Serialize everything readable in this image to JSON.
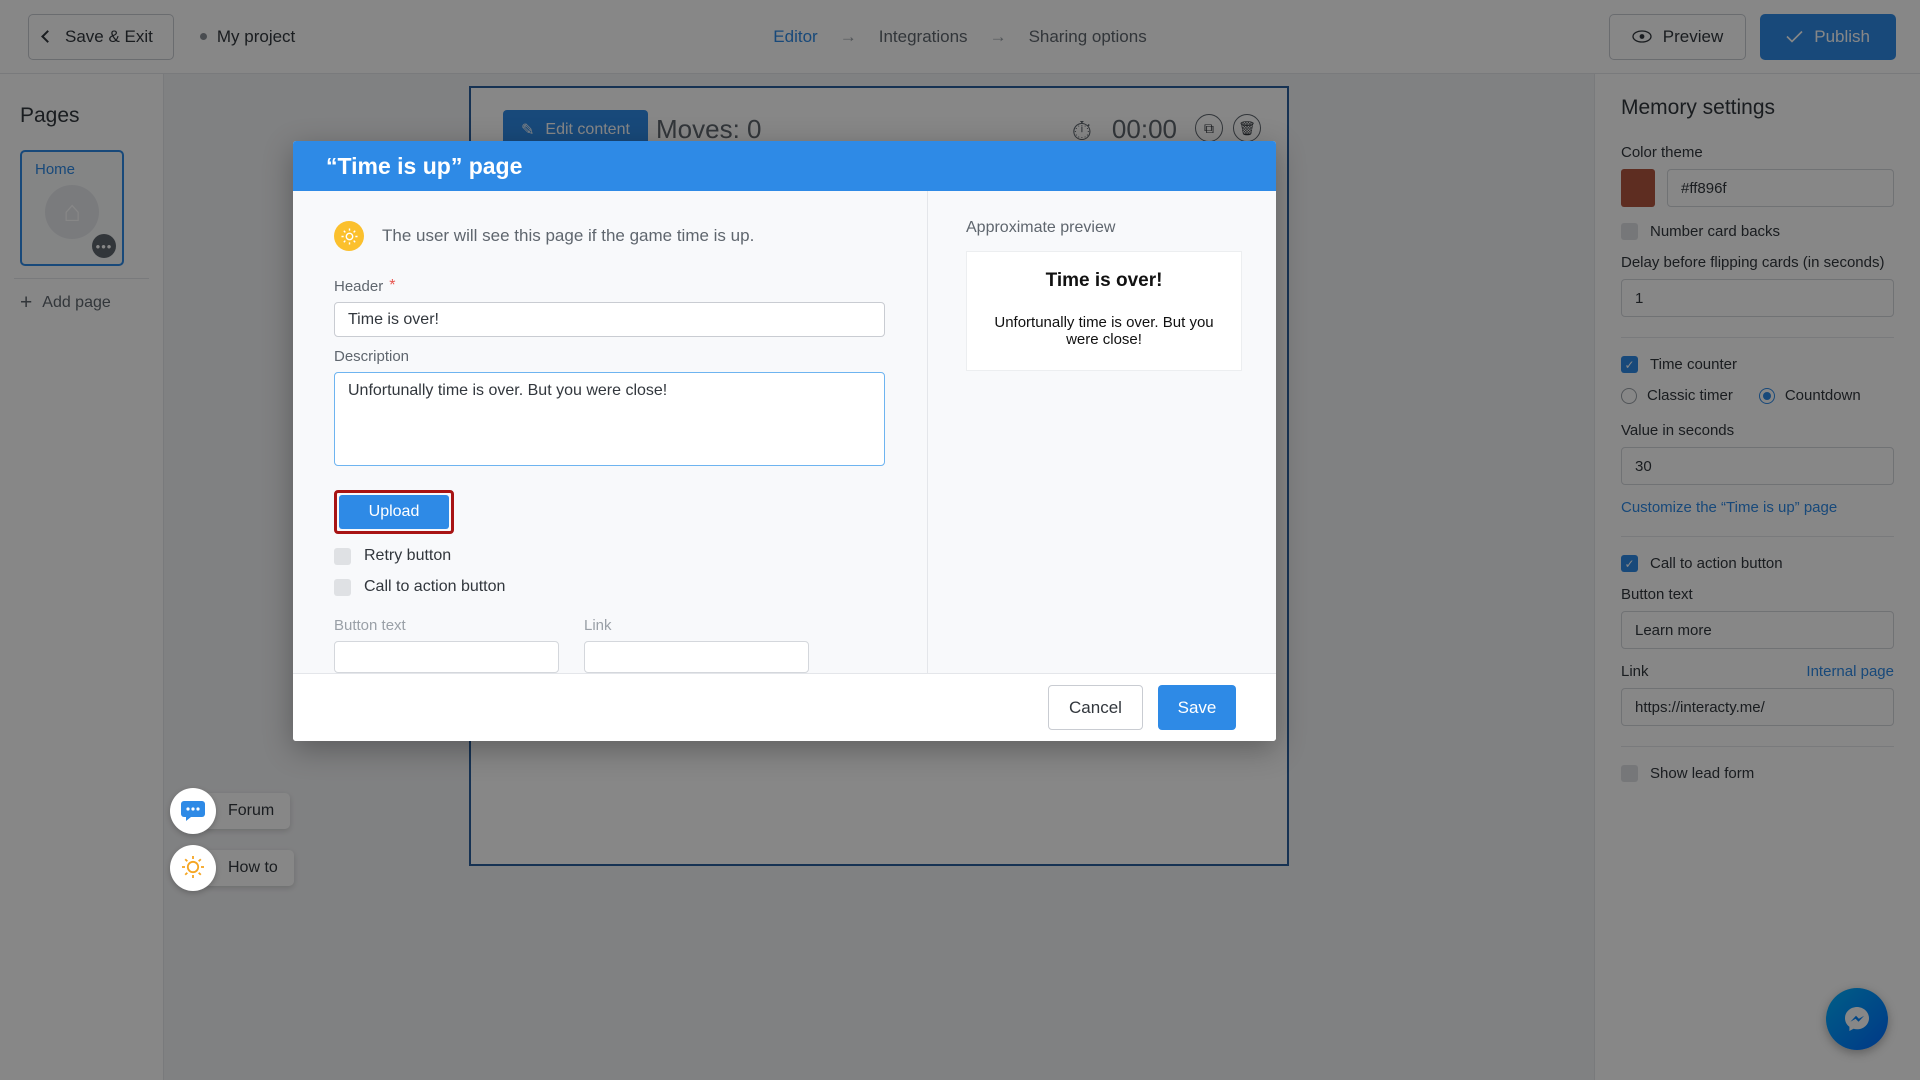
{
  "topbar": {
    "save_exit": "Save & Exit",
    "project_name": "My project",
    "steps": [
      {
        "label": "Editor",
        "active": true
      },
      {
        "label": "Integrations",
        "active": false
      },
      {
        "label": "Sharing options",
        "active": false
      }
    ],
    "step_arrow": "→",
    "preview": "Preview",
    "publish": "Publish",
    "eye_icon": "◉",
    "check_icon": "✓"
  },
  "left_panel": {
    "title": "Pages",
    "page_card": {
      "label": "Home",
      "home_icon": "⌂",
      "more_icon": "•••"
    },
    "add_page": "Add page",
    "plus_icon": "+"
  },
  "canvas": {
    "edit_content": "Edit content",
    "pencil_icon": "✎",
    "moves_text": "Moves: 0",
    "timer_text": "00:00",
    "timer_icon": "⏱",
    "copy_icon": "⧉",
    "trash_icon": "🗑"
  },
  "helpers": [
    {
      "label": "Forum",
      "icon": "💬"
    },
    {
      "label": "How to",
      "icon": "💡"
    }
  ],
  "modal": {
    "title": "“Time is up” page",
    "hint": "The user will see this page if the game time is up.",
    "bulb_icon": "☀",
    "header_label": "Header",
    "required_mark": "*",
    "header_value": "Time is over!",
    "description_label": "Description",
    "description_value": "Unfortunally time is over. But you were close!",
    "upload_button": "Upload",
    "retry_checkbox": "Retry button",
    "cta_checkbox": "Call to action button",
    "button_text_label": "Button text",
    "button_text_value": "",
    "link_label": "Link",
    "link_value": "",
    "preview_label": "Approximate preview",
    "preview_title": "Time is over!",
    "preview_desc": "Unfortunally time is over. But you were close!",
    "cancel": "Cancel",
    "save": "Save",
    "highlight_color": "#a81414"
  },
  "right_panel": {
    "title": "Memory settings",
    "color_theme_label": "Color theme",
    "color_theme_value": "#ff896f",
    "color_swatch": "#b1553f",
    "number_card_backs": "Number card backs",
    "delay_label": "Delay before flipping cards (in seconds)",
    "delay_value": "1",
    "time_counter": "Time counter",
    "classic_timer": "Classic timer",
    "countdown": "Countdown",
    "value_seconds_label": "Value in seconds",
    "value_seconds_value": "30",
    "customize_link": "Customize the “Time is up” page",
    "cta_label": "Call to action button",
    "cta_button_text_label": "Button text",
    "cta_button_text_value": "Learn more",
    "cta_link_label": "Link",
    "cta_internal_page": "Internal page",
    "cta_link_value": "https://interacty.me/",
    "show_lead_form": "Show lead form",
    "check_icon": "✓"
  }
}
